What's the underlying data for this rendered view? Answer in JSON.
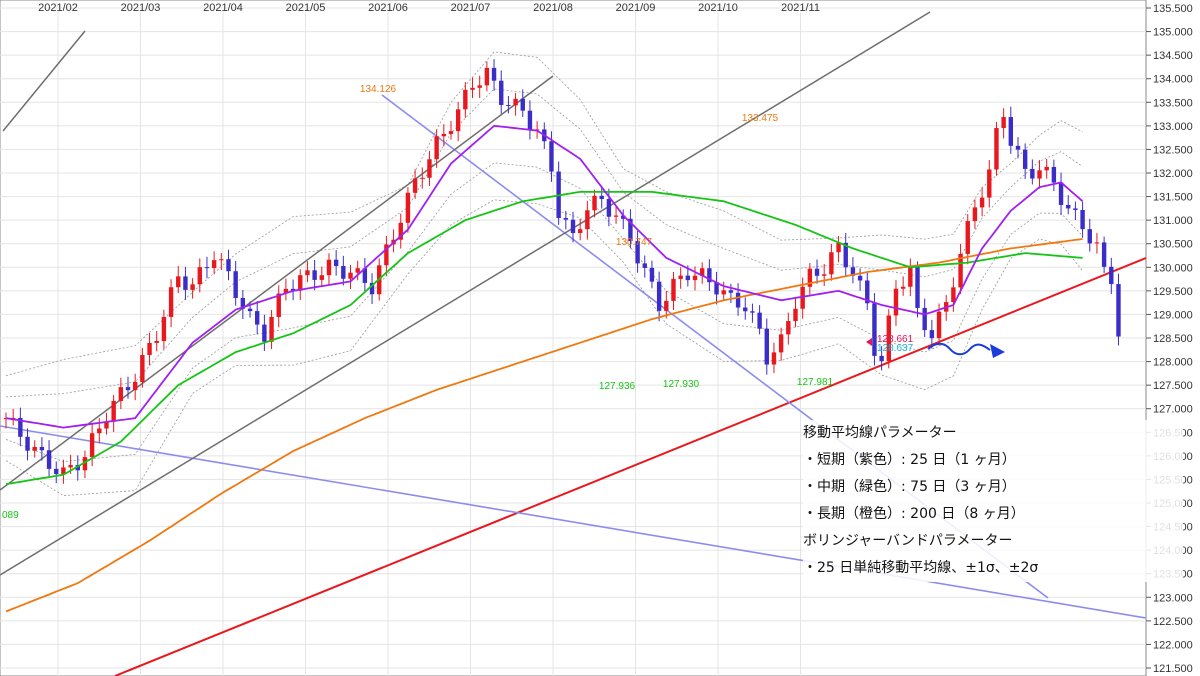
{
  "legend": {
    "title": "移動平均線パラメーター",
    "short": "・短期（紫色）: 25 日（1 ヶ月）",
    "mid": "・中期（緑色）: 75 日（3 ヶ月）",
    "long": "・長期（橙色）: 200 日（8 ヶ月）",
    "bb_title": "ボリンジャーバンドパラメーター",
    "bb": "・25 日単純移動平均線、±1σ、±2σ"
  },
  "colors": {
    "up": "#e8181e",
    "down": "#3b2dc8",
    "ma_short": "#a020f0",
    "ma_mid": "#16c416",
    "ma_long": "#f07810",
    "trend_red": "#e8181e",
    "trend_blue": "#8c8cf0",
    "channel": "#6e6e6e",
    "forecast": "#1a3cdc"
  },
  "chart_data": {
    "type": "candlestick",
    "x_ticks": [
      "2021/02",
      "2021/03",
      "2021/04",
      "2021/05",
      "2021/06",
      "2021/07",
      "2021/08",
      "2021/09",
      "2021/10",
      "2021/11"
    ],
    "y_ticks": [
      "135.500",
      "135.000",
      "134.500",
      "134.000",
      "133.500",
      "133.000",
      "132.500",
      "132.000",
      "131.500",
      "131.000",
      "130.500",
      "130.000",
      "129.500",
      "129.000",
      "128.500",
      "128.000",
      "127.500",
      "127.000",
      "126.500",
      "126.000",
      "125.500",
      "125.000",
      "124.500",
      "124.000",
      "123.500",
      "123.000",
      "122.500",
      "122.000",
      "121.500"
    ],
    "ylim": [
      121.5,
      135.5
    ],
    "annotations": [
      {
        "text": "134.126",
        "color": "#f07810"
      },
      {
        "text": "133.475",
        "color": "#f07810"
      },
      {
        "text": "130.747",
        "color": "#f07810"
      },
      {
        "text": "127.936",
        "color": "#16c416"
      },
      {
        "text": "127.930",
        "color": "#16c416"
      },
      {
        "text": "127.981",
        "color": "#16c416"
      },
      {
        "text": "128.661",
        "color": "#e0185a"
      },
      {
        "text": "128.637",
        "color": "#18b4e0"
      },
      {
        "text": "089",
        "color": "#16c416"
      }
    ],
    "price_path": [
      [
        0,
        126.8
      ],
      [
        4,
        126.1
      ],
      [
        8,
        125.6
      ],
      [
        11,
        126.0
      ],
      [
        14,
        126.9
      ],
      [
        18,
        127.7
      ],
      [
        21,
        128.6
      ],
      [
        24,
        129.8
      ],
      [
        26,
        129.6
      ],
      [
        29,
        130.3
      ],
      [
        31,
        129.8
      ],
      [
        34,
        128.9
      ],
      [
        36,
        128.6
      ],
      [
        39,
        129.6
      ],
      [
        42,
        129.8
      ],
      [
        45,
        130.0
      ],
      [
        48,
        129.9
      ],
      [
        51,
        129.6
      ],
      [
        54,
        130.7
      ],
      [
        57,
        131.8
      ],
      [
        60,
        132.6
      ],
      [
        63,
        133.3
      ],
      [
        65,
        133.9
      ],
      [
        67,
        134.1
      ],
      [
        69,
        133.6
      ],
      [
        72,
        133.3
      ],
      [
        74,
        132.9
      ],
      [
        76,
        132.1
      ],
      [
        77,
        131.2
      ],
      [
        79,
        130.6
      ],
      [
        81,
        131.3
      ],
      [
        83,
        131.4
      ],
      [
        85,
        131.1
      ],
      [
        87,
        130.6
      ],
      [
        89,
        129.9
      ],
      [
        91,
        129.2
      ],
      [
        93,
        129.6
      ],
      [
        95,
        129.9
      ],
      [
        97,
        129.8
      ],
      [
        99,
        129.6
      ],
      [
        101,
        129.3
      ],
      [
        103,
        129.2
      ],
      [
        105,
        128.6
      ],
      [
        106,
        128.1
      ],
      [
        108,
        128.4
      ],
      [
        110,
        129.3
      ],
      [
        112,
        129.8
      ],
      [
        114,
        130.0
      ],
      [
        116,
        130.4
      ],
      [
        118,
        129.9
      ],
      [
        120,
        129.2
      ],
      [
        121,
        128.3
      ],
      [
        122,
        128.0
      ],
      [
        124,
        129.6
      ],
      [
        126,
        129.9
      ],
      [
        127,
        129.0
      ],
      [
        129,
        128.6
      ],
      [
        131,
        129.2
      ],
      [
        133,
        130.3
      ],
      [
        135,
        131.3
      ],
      [
        137,
        132.0
      ],
      [
        138,
        132.8
      ],
      [
        139,
        133.3
      ],
      [
        140,
        132.7
      ],
      [
        142,
        132.0
      ],
      [
        144,
        132.1
      ],
      [
        146,
        131.8
      ],
      [
        148,
        131.2
      ],
      [
        150,
        130.9
      ],
      [
        152,
        130.4
      ],
      [
        153,
        129.9
      ],
      [
        154,
        129.8
      ],
      [
        155,
        128.6
      ]
    ],
    "ma_short_path": [
      [
        0,
        126.8
      ],
      [
        8,
        126.6
      ],
      [
        18,
        126.8
      ],
      [
        26,
        128.4
      ],
      [
        32,
        129.1
      ],
      [
        40,
        129.5
      ],
      [
        48,
        129.7
      ],
      [
        56,
        130.8
      ],
      [
        62,
        132.2
      ],
      [
        68,
        133.0
      ],
      [
        74,
        132.9
      ],
      [
        80,
        132.3
      ],
      [
        86,
        131.1
      ],
      [
        92,
        130.2
      ],
      [
        100,
        129.6
      ],
      [
        108,
        129.3
      ],
      [
        116,
        129.5
      ],
      [
        122,
        129.2
      ],
      [
        128,
        129.0
      ],
      [
        132,
        129.2
      ],
      [
        136,
        130.4
      ],
      [
        140,
        131.2
      ],
      [
        144,
        131.7
      ],
      [
        147,
        131.8
      ],
      [
        150,
        131.4
      ]
    ],
    "ma_mid_path": [
      [
        0,
        125.4
      ],
      [
        8,
        125.6
      ],
      [
        16,
        126.3
      ],
      [
        24,
        127.5
      ],
      [
        32,
        128.2
      ],
      [
        40,
        128.6
      ],
      [
        48,
        129.2
      ],
      [
        56,
        130.3
      ],
      [
        64,
        131.0
      ],
      [
        72,
        131.4
      ],
      [
        80,
        131.6
      ],
      [
        90,
        131.6
      ],
      [
        100,
        131.4
      ],
      [
        110,
        130.9
      ],
      [
        118,
        130.4
      ],
      [
        126,
        130.0
      ],
      [
        134,
        130.1
      ],
      [
        142,
        130.3
      ],
      [
        150,
        130.2
      ]
    ],
    "ma_long_path": [
      [
        0,
        122.7
      ],
      [
        10,
        123.3
      ],
      [
        20,
        124.2
      ],
      [
        30,
        125.2
      ],
      [
        40,
        126.1
      ],
      [
        50,
        126.8
      ],
      [
        60,
        127.4
      ],
      [
        70,
        127.9
      ],
      [
        80,
        128.4
      ],
      [
        90,
        128.9
      ],
      [
        100,
        129.3
      ],
      [
        110,
        129.6
      ],
      [
        120,
        129.9
      ],
      [
        130,
        130.1
      ],
      [
        140,
        130.4
      ],
      [
        150,
        130.6
      ]
    ]
  }
}
